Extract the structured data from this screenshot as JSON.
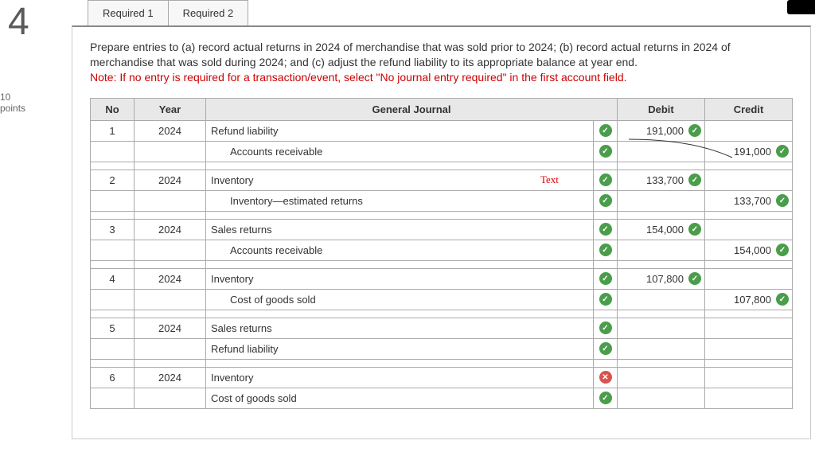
{
  "attempt_number": "4",
  "points_line1": "10",
  "points_line2": "points",
  "tabs": [
    "Required 1",
    "Required 2"
  ],
  "instructions": "Prepare entries to (a) record actual returns in 2024 of merchandise that was sold prior to 2024; (b) record actual returns in 2024 of merchandise that was sold during 2024; and (c) adjust the refund liability to its appropriate balance at year end.",
  "note": "Note: If no entry is required for a transaction/event, select \"No journal entry required\" in the first account field.",
  "headers": {
    "no": "No",
    "year": "Year",
    "journal": "General Journal",
    "debit": "Debit",
    "credit": "Credit"
  },
  "annotation": "Text",
  "entries": [
    {
      "no": "1",
      "year": "2024",
      "lines": [
        {
          "account": "Refund liability",
          "status": "check",
          "debit": "191,000",
          "debit_status": "check",
          "credit": ""
        },
        {
          "account": "Accounts receivable",
          "indent": true,
          "status": "check",
          "debit": "",
          "credit": "191,000",
          "credit_status": "check"
        }
      ]
    },
    {
      "no": "2",
      "year": "2024",
      "lines": [
        {
          "account": "Inventory",
          "status": "check",
          "debit": "133,700",
          "debit_status": "check",
          "credit": "",
          "annot": true
        },
        {
          "account": "Inventory—estimated returns",
          "indent": true,
          "status": "check",
          "debit": "",
          "credit": "133,700",
          "credit_status": "check"
        }
      ]
    },
    {
      "no": "3",
      "year": "2024",
      "lines": [
        {
          "account": "Sales returns",
          "status": "check",
          "debit": "154,000",
          "debit_status": "check",
          "credit": ""
        },
        {
          "account": "Accounts receivable",
          "indent": true,
          "status": "check",
          "debit": "",
          "credit": "154,000",
          "credit_status": "check"
        }
      ]
    },
    {
      "no": "4",
      "year": "2024",
      "lines": [
        {
          "account": "Inventory",
          "status": "check",
          "debit": "107,800",
          "debit_status": "check",
          "credit": ""
        },
        {
          "account": "Cost of goods sold",
          "indent": true,
          "status": "check",
          "debit": "",
          "credit": "107,800",
          "credit_status": "check"
        }
      ]
    },
    {
      "no": "5",
      "year": "2024",
      "lines": [
        {
          "account": "Sales returns",
          "status": "check",
          "debit": "",
          "credit": ""
        },
        {
          "account": "Refund liability",
          "status": "check",
          "debit": "",
          "credit": ""
        }
      ]
    },
    {
      "no": "6",
      "year": "2024",
      "lines": [
        {
          "account": "Inventory",
          "status": "cross",
          "debit": "",
          "credit": "",
          "error": true
        },
        {
          "account": "Cost of goods sold",
          "status": "check",
          "debit": "",
          "credit": ""
        }
      ]
    }
  ]
}
